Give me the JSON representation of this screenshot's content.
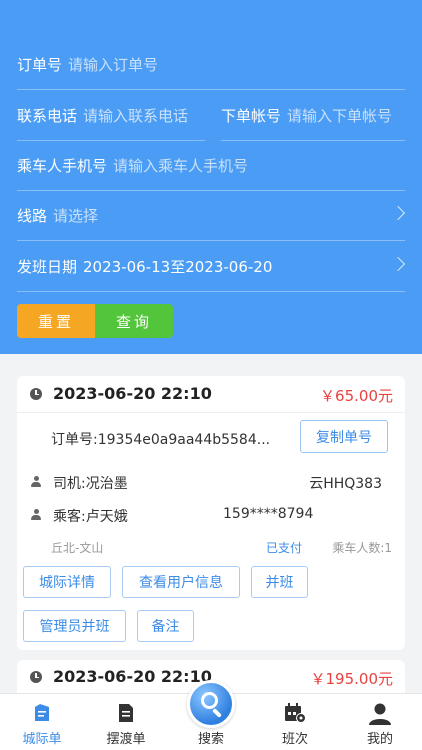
{
  "filters": {
    "order_no": {
      "label": "订单号",
      "placeholder": "请输入订单号"
    },
    "contact_phone": {
      "label": "联系电话",
      "placeholder": "请输入联系电话"
    },
    "order_account": {
      "label": "下单帐号",
      "placeholder": "请输入下单帐号"
    },
    "passenger_phone": {
      "label": "乘车人手机号",
      "placeholder": "请输入乘车人手机号"
    },
    "route": {
      "label": "线路",
      "placeholder": "请选择"
    },
    "date": {
      "label": "发班日期",
      "value": "2023-06-13至2023-06-20"
    },
    "reset_label": "重置",
    "query_label": "查询"
  },
  "orders": [
    {
      "time": "2023-06-20 22:10",
      "price": "￥65.00元",
      "order_no": "订单号:19354e0a9aa44b5584...",
      "copy_label": "复制单号",
      "driver": "司机:况治墨",
      "plate": "云HHQ383",
      "passenger": "乘客:卢天娥",
      "passenger_phone": "159****8794",
      "route": "丘北-文山",
      "pay_status": "已支付",
      "passenger_count": "乘车人数:1",
      "actions": [
        "城际详情",
        "查看用户信息",
        "并班",
        "管理员并班",
        "备注"
      ]
    },
    {
      "time": "2023-06-20 22:10",
      "price": "￥195.00元"
    }
  ],
  "tabbar": {
    "items": [
      {
        "label": "城际单",
        "icon": "ticket-icon",
        "active": true
      },
      {
        "label": "摆渡单",
        "icon": "document-icon",
        "active": false
      },
      {
        "label": "搜索",
        "icon": "search-icon",
        "active": false
      },
      {
        "label": "班次",
        "icon": "schedule-icon",
        "active": false
      },
      {
        "label": "我的",
        "icon": "user-icon",
        "active": false
      }
    ]
  },
  "colors": {
    "header_bg": "#4a9cf4",
    "reset": "#f5a623",
    "query": "#53c53a",
    "price": "#e64340",
    "accent": "#3c8ce7"
  }
}
